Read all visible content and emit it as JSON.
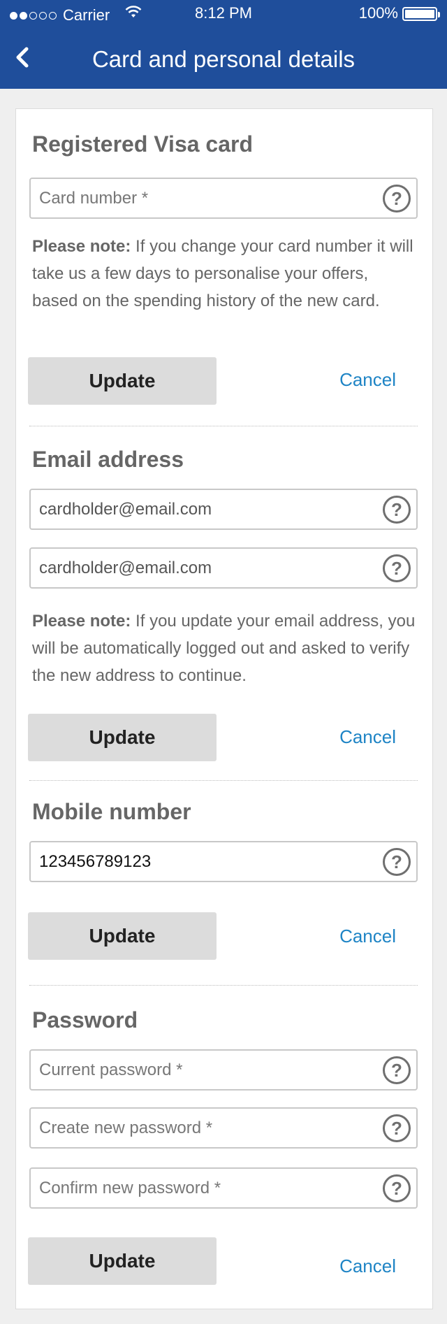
{
  "status_bar": {
    "carrier": "Carrier",
    "time": "8:12 PM",
    "battery": "100%",
    "signal_bars_filled": 2,
    "signal_bars_total": 5
  },
  "nav": {
    "back_icon": "chevron-left-icon",
    "title": "Card and personal details"
  },
  "colors": {
    "header_bg": "#1f4e9b",
    "link": "#1e84c5",
    "button_bg": "#dcdcdc"
  },
  "visa_section": {
    "title": "Registered  Visa card",
    "card_number_placeholder": "Card number *",
    "note_label": "Please note:",
    "note_text": " If you change your card number it will take us a few days to personalise your offers, based on the spending history of the new card.",
    "update_label": "Update",
    "cancel_label": "Cancel"
  },
  "email_section": {
    "title": "Email address",
    "email_value": "cardholder@email.com",
    "confirm_email_value": "cardholder@email.com",
    "note_label": "Please note:",
    "note_text": " If you update your email address, you will be automatically logged out and asked to verify the new address to continue.",
    "update_label": "Update",
    "cancel_label": "Cancel"
  },
  "mobile_section": {
    "title": "Mobile number",
    "mobile_value": "123456789123",
    "update_label": "Update",
    "cancel_label": "Cancel"
  },
  "password_section": {
    "title": "Password",
    "current_placeholder": "Current password *",
    "new_placeholder": "Create new password *",
    "confirm_placeholder": "Confirm new password *",
    "update_label": "Update",
    "cancel_label": "Cancel"
  },
  "help_symbol": "?"
}
